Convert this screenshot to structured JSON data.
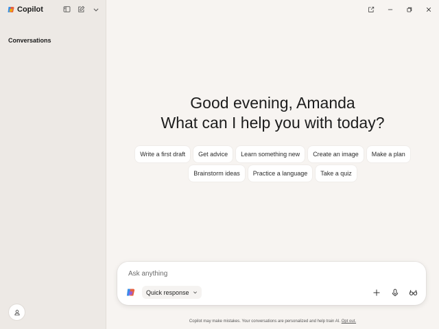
{
  "app": {
    "name": "Copilot",
    "brand_colors": [
      "#e8613f",
      "#f4b400",
      "#3a8ee6",
      "#8a5cf6"
    ]
  },
  "sidebar": {
    "icons": [
      "sidebar-toggle-icon",
      "new-chat-icon",
      "chevron-down-icon"
    ],
    "section_title": "Conversations",
    "profile_icon": "person-icon"
  },
  "window": {
    "controls": [
      "open-external-icon",
      "minimize-icon",
      "restore-icon",
      "close-icon"
    ]
  },
  "main": {
    "greeting_line1": "Good evening, Amanda",
    "greeting_line2": "What can I help you with today?",
    "chips_row1": [
      "Write a first draft",
      "Get advice",
      "Learn something new",
      "Create an image",
      "Make a plan"
    ],
    "chips_row2": [
      "Brainstorm ideas",
      "Practice a language",
      "Take a quiz"
    ]
  },
  "composer": {
    "placeholder": "Ask anything",
    "mode_label": "Quick response",
    "actions": [
      "plus-icon",
      "microphone-icon",
      "glasses-icon"
    ]
  },
  "footer": {
    "disclaimer": "Copilot may make mistakes. Your conversations are personalized and help train AI.",
    "opt_out": "Opt out."
  }
}
